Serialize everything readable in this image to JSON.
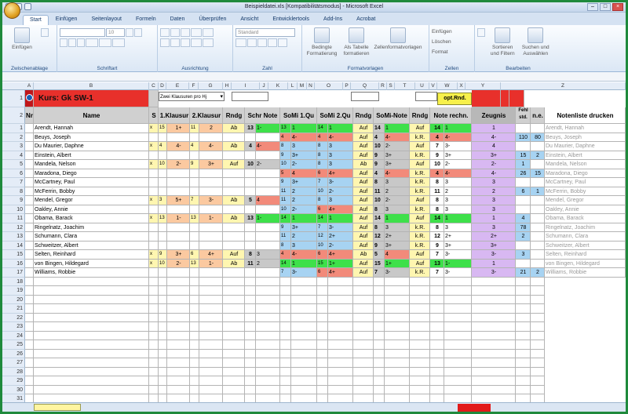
{
  "window": {
    "title": "Beispieldatei.xls  [Kompatibilitätsmodus]  -  Microsoft Excel"
  },
  "tabs": [
    "Start",
    "Einfügen",
    "Seitenlayout",
    "Formeln",
    "Daten",
    "Überprüfen",
    "Ansicht",
    "Entwicklertools",
    "Add-Ins",
    "Acrobat"
  ],
  "ribbon": {
    "paste_label": "Einfügen",
    "clipboard_group": "Zwischenablage",
    "font_group": "Schriftart",
    "font_size": "10",
    "align_group": "Ausrichtung",
    "number_format": "Standard",
    "number_group": "Zahl",
    "cond_format": "Bedingte Formatierung",
    "table_format": "Als Tabelle formatieren",
    "cell_styles": "Zellenformatvorlagen",
    "styles_group": "Formatvorlagen",
    "insert_cells": "Einfügen",
    "delete_cells": "Löschen",
    "format_cells": "Format",
    "cells_group": "Zellen",
    "sort_filter": "Sortieren und Filtern",
    "find_select": "Suchen und Auswählen",
    "edit_group": "Bearbeiten"
  },
  "columns": [
    "A",
    "B",
    "C",
    "D",
    "E",
    "F",
    "G",
    "H",
    "I",
    "J",
    "K",
    "L",
    "M",
    "N",
    "O",
    "P",
    "Q",
    "R",
    "S",
    "T",
    "U",
    "V",
    "W",
    "X",
    "Y",
    "Z"
  ],
  "header": {
    "course": "Kurs:  Gk SW-1",
    "dropdown": "Zwei Klausuren pro Hj",
    "opt_button": "opt.Rnd.",
    "nr": "Nr",
    "name": "Name",
    "s": "S",
    "k1": "1.Klausur",
    "k2": "2.Klausur",
    "rndg": "Rndg",
    "schr": "Schr Note",
    "somi1": "SoMi 1.Qu",
    "somi2": "SoMi 2.Qu",
    "rndg2": "Rndg",
    "somi_note": "SoMi-Note",
    "rndg3": "Rndg",
    "note_rechn": "Note rechn.",
    "zeugnis": "Zeugnis",
    "fehl": "Fehl std.",
    "ne": "n.e.",
    "notenliste": "Notenliste drucken"
  },
  "students": [
    {
      "nr": "1",
      "name": "Arendt, Hannah",
      "s": "x",
      "k1p": "15",
      "k1": "1+",
      "k2p": "11",
      "k2": "2",
      "rndg": "Ab",
      "schrp": "13",
      "schr": "1-",
      "s1p": "13",
      "s1": "1",
      "s2p": "14",
      "s2": "1",
      "rndg2": "Auf",
      "smp": "14",
      "sm": "1",
      "rndg3": "Auf",
      "ncp": "14",
      "nc": "1",
      "zeug": "1",
      "fehl": "",
      "ne": "",
      "print": "Arendt, Hannah"
    },
    {
      "nr": "2",
      "name": "Beuys, Joseph",
      "s": "",
      "k1p": "",
      "k1": "",
      "k2p": "",
      "k2": "",
      "rndg": "",
      "schrp": "",
      "schr": "",
      "s1p": "4",
      "s1": "4-",
      "s2p": "4",
      "s2": "4-",
      "rndg2": "Auf",
      "smp": "4",
      "sm": "4-",
      "rndg3": "k.R.",
      "ncp": "4",
      "nc": "4-",
      "zeug": "4-",
      "fehl": "110",
      "ne": "80",
      "print": "Beuys, Joseph"
    },
    {
      "nr": "3",
      "name": "Du Maurier, Daphne",
      "s": "x",
      "k1p": "4",
      "k1": "4-",
      "k2p": "4",
      "k2": "4-",
      "rndg": "Ab",
      "schrp": "4",
      "schr": "4-",
      "s1p": "8",
      "s1": "3",
      "s2p": "8",
      "s2": "3",
      "rndg2": "Auf",
      "smp": "10",
      "sm": "2-",
      "rndg3": "Auf",
      "ncp": "7",
      "nc": "3-",
      "zeug": "4",
      "fehl": "",
      "ne": "",
      "print": "Du Maurier, Daphne"
    },
    {
      "nr": "4",
      "name": "Einstein, Albert",
      "s": "",
      "k1p": "",
      "k1": "",
      "k2p": "",
      "k2": "",
      "rndg": "",
      "schrp": "",
      "schr": "",
      "s1p": "9",
      "s1": "3+",
      "s2p": "8",
      "s2": "3",
      "rndg2": "Auf",
      "smp": "9",
      "sm": "3+",
      "rndg3": "k.R.",
      "ncp": "9",
      "nc": "3+",
      "zeug": "3+",
      "fehl": "15",
      "ne": "2",
      "print": "Einstein, Albert"
    },
    {
      "nr": "5",
      "name": "Mandela, Nelson",
      "s": "x",
      "k1p": "10",
      "k1": "2-",
      "k2p": "9",
      "k2": "3+",
      "rndg": "Auf",
      "schrp": "10",
      "schr": "2-",
      "s1p": "10",
      "s1": "2-",
      "s2p": "8",
      "s2": "3",
      "rndg2": "Ab",
      "smp": "9",
      "sm": "3+",
      "rndg3": "Auf",
      "ncp": "10",
      "nc": "2-",
      "zeug": "2-",
      "fehl": "1",
      "ne": "",
      "print": "Mandela, Nelson"
    },
    {
      "nr": "6",
      "name": "Maradona, Diego",
      "s": "",
      "k1p": "",
      "k1": "",
      "k2p": "",
      "k2": "",
      "rndg": "",
      "schrp": "",
      "schr": "",
      "s1p": "5",
      "s1": "4",
      "s2p": "6",
      "s2": "4+",
      "rndg2": "Auf",
      "smp": "4",
      "sm": "4-",
      "rndg3": "k.R.",
      "ncp": "4",
      "nc": "4-",
      "zeug": "4-",
      "fehl": "26",
      "ne": "15",
      "print": "Maradona, Diego"
    },
    {
      "nr": "7",
      "name": "McCartney, Paul",
      "s": "",
      "k1p": "",
      "k1": "",
      "k2p": "",
      "k2": "",
      "rndg": "",
      "schrp": "",
      "schr": "",
      "s1p": "9",
      "s1": "3+",
      "s2p": "7",
      "s2": "3-",
      "rndg2": "Auf",
      "smp": "8",
      "sm": "3",
      "rndg3": "k.R.",
      "ncp": "8",
      "nc": "3",
      "zeug": "3",
      "fehl": "",
      "ne": "",
      "print": "McCartney, Paul"
    },
    {
      "nr": "8",
      "name": "McFerrin, Bobby",
      "s": "",
      "k1p": "",
      "k1": "",
      "k2p": "",
      "k2": "",
      "rndg": "",
      "schrp": "",
      "schr": "",
      "s1p": "11",
      "s1": "2",
      "s2p": "10",
      "s2": "2-",
      "rndg2": "Auf",
      "smp": "11",
      "sm": "2",
      "rndg3": "k.R.",
      "ncp": "11",
      "nc": "2",
      "zeug": "2",
      "fehl": "6",
      "ne": "1",
      "print": "McFerrin, Bobby"
    },
    {
      "nr": "9",
      "name": "Mendel, Gregor",
      "s": "x",
      "k1p": "3",
      "k1": "5+",
      "k2p": "7",
      "k2": "3-",
      "rndg": "Ab",
      "schrp": "5",
      "schr": "4",
      "s1p": "11",
      "s1": "2",
      "s2p": "8",
      "s2": "3",
      "rndg2": "Auf",
      "smp": "10",
      "sm": "2-",
      "rndg3": "Auf",
      "ncp": "8",
      "nc": "3",
      "zeug": "3",
      "fehl": "",
      "ne": "",
      "print": "Mendel, Gregor"
    },
    {
      "nr": "10",
      "name": "Oakley, Annie",
      "s": "",
      "k1p": "",
      "k1": "",
      "k2p": "",
      "k2": "",
      "rndg": "",
      "schrp": "",
      "schr": "",
      "s1p": "10",
      "s1": "2-",
      "s2p": "6",
      "s2": "4+",
      "rndg2": "Auf",
      "smp": "8",
      "sm": "3",
      "rndg3": "k.R.",
      "ncp": "8",
      "nc": "3",
      "zeug": "3",
      "fehl": "",
      "ne": "",
      "print": "Oakley, Annie"
    },
    {
      "nr": "11",
      "name": "Obama, Barack",
      "s": "x",
      "k1p": "13",
      "k1": "1-",
      "k2p": "13",
      "k2": "1-",
      "rndg": "Ab",
      "schrp": "13",
      "schr": "1-",
      "s1p": "14",
      "s1": "1",
      "s2p": "14",
      "s2": "1",
      "rndg2": "Auf",
      "smp": "14",
      "sm": "1",
      "rndg3": "Auf",
      "ncp": "14",
      "nc": "1",
      "zeug": "1",
      "fehl": "4",
      "ne": "",
      "print": "Obama, Barack"
    },
    {
      "nr": "12",
      "name": "Ringelnatz, Joachim",
      "s": "",
      "k1p": "",
      "k1": "",
      "k2p": "",
      "k2": "",
      "rndg": "",
      "schrp": "",
      "schr": "",
      "s1p": "9",
      "s1": "3+",
      "s2p": "7",
      "s2": "3-",
      "rndg2": "Auf",
      "smp": "8",
      "sm": "3",
      "rndg3": "k.R.",
      "ncp": "8",
      "nc": "3",
      "zeug": "3",
      "fehl": "78",
      "ne": "",
      "print": "Ringelnatz, Joachim"
    },
    {
      "nr": "13",
      "name": "Schumann, Clara",
      "s": "",
      "k1p": "",
      "k1": "",
      "k2p": "",
      "k2": "",
      "rndg": "",
      "schrp": "",
      "schr": "",
      "s1p": "11",
      "s1": "2",
      "s2p": "12",
      "s2": "2+",
      "rndg2": "Auf",
      "smp": "12",
      "sm": "2+",
      "rndg3": "k.R.",
      "ncp": "12",
      "nc": "2+",
      "zeug": "2+",
      "fehl": "2",
      "ne": "",
      "print": "Schumann, Clara"
    },
    {
      "nr": "14",
      "name": "Schweitzer, Albert",
      "s": "",
      "k1p": "",
      "k1": "",
      "k2p": "",
      "k2": "",
      "rndg": "",
      "schrp": "",
      "schr": "",
      "s1p": "8",
      "s1": "3",
      "s2p": "10",
      "s2": "2-",
      "rndg2": "Auf",
      "smp": "9",
      "sm": "3+",
      "rndg3": "k.R.",
      "ncp": "9",
      "nc": "3+",
      "zeug": "3+",
      "fehl": "",
      "ne": "",
      "print": "Schweitzer, Albert"
    },
    {
      "nr": "15",
      "name": "Selten, Reinhard",
      "s": "x",
      "k1p": "9",
      "k1": "3+",
      "k2p": "6",
      "k2": "4+",
      "rndg": "Auf",
      "schrp": "8",
      "schr": "3",
      "s1p": "4",
      "s1": "4-",
      "s2p": "6",
      "s2": "4+",
      "rndg2": "Ab",
      "smp": "5",
      "sm": "4",
      "rndg3": "Auf",
      "ncp": "7",
      "nc": "3-",
      "zeug": "3-",
      "fehl": "3",
      "ne": "",
      "print": "Selten, Reinhard"
    },
    {
      "nr": "16",
      "name": "von Bingen, Hildegard",
      "s": "x",
      "k1p": "10",
      "k1": "2-",
      "k2p": "13",
      "k2": "1-",
      "rndg": "Ab",
      "schrp": "11",
      "schr": "2",
      "s1p": "14",
      "s1": "1",
      "s2p": "15",
      "s2": "1+",
      "rndg2": "Auf",
      "smp": "15",
      "sm": "1+",
      "rndg3": "Auf",
      "ncp": "13",
      "nc": "1-",
      "zeug": "1",
      "fehl": "",
      "ne": "",
      "print": "von Bingen, Hildegard"
    },
    {
      "nr": "17",
      "name": "Williams, Robbie",
      "s": "",
      "k1p": "",
      "k1": "",
      "k2p": "",
      "k2": "",
      "rndg": "",
      "schrp": "",
      "schr": "",
      "s1p": "7",
      "s1": "3-",
      "s2p": "6",
      "s2": "4+",
      "rndg2": "Auf",
      "smp": "7",
      "sm": "3-",
      "rndg3": "k.R.",
      "ncp": "7",
      "nc": "3-",
      "zeug": "3-",
      "fehl": "21",
      "ne": "2",
      "print": "Williams, Robbie"
    }
  ],
  "empty_rows": [
    "18",
    "19",
    "20",
    "21",
    "22",
    "23",
    "24",
    "25",
    "26",
    "27",
    "28",
    "29",
    "30",
    "31",
    "32",
    "33"
  ],
  "colors": {
    "red": "#e8302b",
    "green": "#3ee04a",
    "blue": "#a7d3f2",
    "purple": "#d8b8f2",
    "salmon": "#f28a7a",
    "orange": "#fbc9a0",
    "yellow": "#fff6b0",
    "gray": "#c8c8c8",
    "header_gray": "#d0d0d0",
    "print_text": "#999999"
  }
}
